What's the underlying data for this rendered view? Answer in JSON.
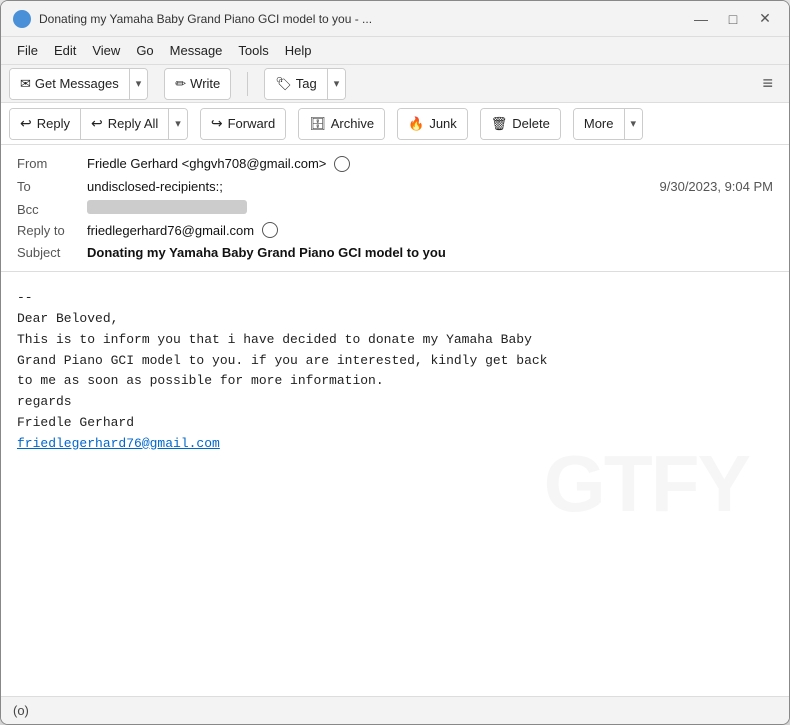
{
  "titlebar": {
    "title": "Donating my Yamaha Baby Grand Piano GCI model to you - ...",
    "icon": "thunderbird-icon",
    "controls": {
      "minimize": "—",
      "maximize": "□",
      "close": "✕"
    }
  },
  "menubar": {
    "items": [
      "File",
      "Edit",
      "View",
      "Go",
      "Message",
      "Tools",
      "Help"
    ]
  },
  "toolbar": {
    "get_messages": "Get Messages",
    "write": "Write",
    "tag": "Tag",
    "hamburger": "≡"
  },
  "action_toolbar": {
    "reply": "Reply",
    "reply_all": "Reply All",
    "forward": "Forward",
    "archive": "Archive",
    "junk": "Junk",
    "delete": "Delete",
    "more": "More"
  },
  "email": {
    "from_label": "From",
    "from_value": "Friedle Gerhard <ghgvh708@gmail.com>",
    "to_label": "To",
    "to_value": "undisclosed-recipients:;",
    "date": "9/30/2023, 9:04 PM",
    "bcc_label": "Bcc",
    "bcc_value": "",
    "reply_to_label": "Reply to",
    "reply_to_value": "friedlegerhard76@gmail.com",
    "subject_label": "Subject",
    "subject_value": "Donating my Yamaha Baby Grand Piano GCI model to you",
    "body_line1": "--",
    "body_line2": "Dear Beloved,",
    "body_line3": "  This is to inform you that i have decided to donate my Yamaha Baby",
    "body_line4": "Grand Piano GCI model to you. if you are interested, kindly get back",
    "body_line5": "to me as soon as possible for more information.",
    "body_line6": "   regards",
    "body_line7": "Friedle Gerhard",
    "body_link": "friedlegerhard76@gmail.com"
  },
  "statusbar": {
    "icon": "(◉)",
    "text": "(o)"
  },
  "icons": {
    "reply": "↩",
    "reply_all": "↩↩",
    "forward": "↪",
    "archive": "🗄",
    "junk": "🔥",
    "delete": "🗑",
    "envelope": "✉",
    "pencil": "✏",
    "tag": "🏷",
    "chevron_down": "▾",
    "person": "👤"
  }
}
